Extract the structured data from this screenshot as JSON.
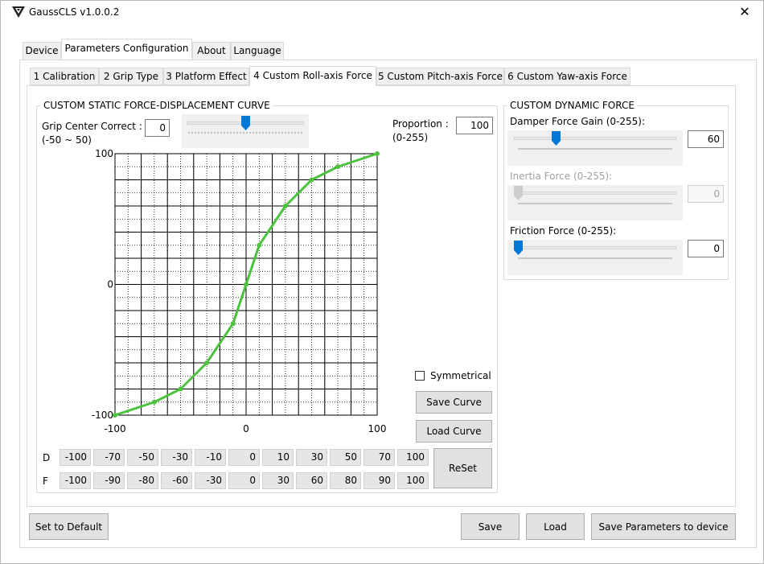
{
  "window": {
    "title": "GaussCLS v1.0.0.2",
    "close_glyph": "✕"
  },
  "main_tabs": [
    {
      "label": "Device",
      "active": false
    },
    {
      "label": "Parameters Configuration",
      "active": true
    },
    {
      "label": "About",
      "active": false
    },
    {
      "label": "Language",
      "active": false
    }
  ],
  "sub_tabs": [
    {
      "label": "1 Calibration",
      "active": false
    },
    {
      "label": "2 Grip Type",
      "active": false
    },
    {
      "label": "3 Platform Effect",
      "active": false
    },
    {
      "label": "4 Custom Roll-axis Force",
      "active": true
    },
    {
      "label": "5 Custom Pitch-axis Force",
      "active": false
    },
    {
      "label": "6 Custom Yaw-axis Force",
      "active": false
    }
  ],
  "static_curve": {
    "group_title": "CUSTOM STATIC FORCE-DISPLACEMENT CURVE",
    "grip_center": {
      "label": "Grip Center Correct :",
      "range": "(-50 ~ 50)",
      "value": "0",
      "slider_level": 0.5
    },
    "proportion": {
      "label": "Proportion :",
      "range": "(0-255)",
      "value": "100"
    },
    "symmetrical": {
      "label": "Symmetrical",
      "checked": false
    },
    "save_curve_label": "Save Curve",
    "load_curve_label": "Load Curve",
    "reset_label": "ReSet",
    "row_labels": {
      "d": "D",
      "f": "F"
    },
    "d_values": [
      "-100",
      "-70",
      "-50",
      "-30",
      "-10",
      "0",
      "10",
      "30",
      "50",
      "70",
      "100"
    ],
    "f_values": [
      "-100",
      "-90",
      "-80",
      "-60",
      "-30",
      "0",
      "30",
      "60",
      "80",
      "90",
      "100"
    ]
  },
  "chart_data": {
    "type": "line",
    "x": [
      -100,
      -70,
      -50,
      -30,
      -10,
      0,
      10,
      30,
      50,
      70,
      100
    ],
    "y": [
      -100,
      -90,
      -80,
      -60,
      -30,
      0,
      30,
      60,
      80,
      90,
      100
    ],
    "xlim": [
      -100,
      100
    ],
    "ylim": [
      -100,
      100
    ],
    "x_tick_labels": [
      "-100",
      "0",
      "100"
    ],
    "y_tick_labels": [
      "100",
      "0",
      "-100"
    ],
    "grid": true,
    "line_color": "#4cc23f",
    "title": "",
    "xlabel": "",
    "ylabel": ""
  },
  "dynamic_force": {
    "group_title": "CUSTOM DYNAMIC FORCE",
    "damper": {
      "label": "Damper Force Gain (0-255):",
      "value": "60",
      "slider_level": 0.235,
      "enabled": true
    },
    "inertia": {
      "label": "Inertia Force (0-255):",
      "value": "0",
      "slider_level": 0,
      "enabled": false
    },
    "friction": {
      "label": "Friction Force (0-255):",
      "value": "0",
      "slider_level": 0,
      "enabled": true
    }
  },
  "footer": {
    "set_default_label": "Set to Default",
    "save_label": "Save",
    "load_label": "Load",
    "save_device_label": "Save Parameters to device"
  },
  "colors": {
    "accent": "#0078d7",
    "curve": "#4cc23f",
    "disabled_text": "#a0a0a0"
  }
}
